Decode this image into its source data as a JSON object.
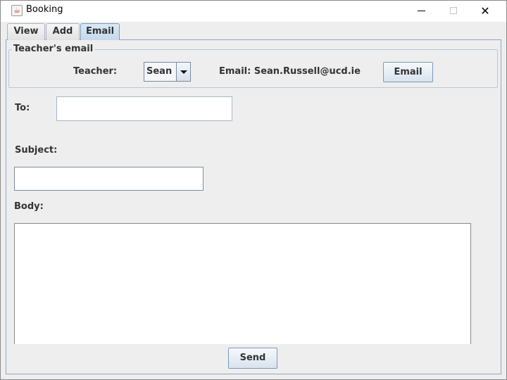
{
  "window": {
    "title": "Booking",
    "app_icon_glyph": "☕",
    "controls": {
      "minimize": "minimize-icon",
      "maximize": "maximize-icon",
      "close": "✕"
    }
  },
  "tabs": [
    {
      "label": "View",
      "selected": false
    },
    {
      "label": "Add",
      "selected": false
    },
    {
      "label": "Email",
      "selected": true
    }
  ],
  "teacher_group": {
    "title": "Teacher's email",
    "teacher_label": "Teacher:",
    "teacher_selected": "Sean",
    "email_text": "Email: Sean.Russell@ucd.ie",
    "email_button": "Email"
  },
  "form": {
    "to_label": "To:",
    "to_value": "",
    "subject_label": "Subject:",
    "subject_value": "",
    "body_label": "Body:",
    "body_value": ""
  },
  "send_button": "Send",
  "colors": {
    "window_bg": "#eeeeee",
    "accent_border": "#7a9cc0",
    "selected_tab": "#c6d9ec"
  }
}
